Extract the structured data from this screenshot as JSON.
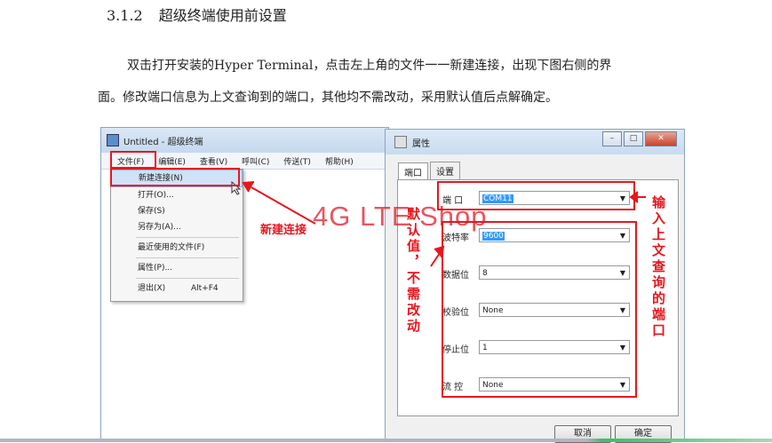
{
  "section": {
    "number": "3.1.2",
    "title": "超级终端使用前设置"
  },
  "paragraph": {
    "line1": "双击打开安装的Hyper Terminal，点击左上角的文件一一新建连接，出现下图右侧的界",
    "line2": "面。修改端口信息为上文查询到的端口，其他均不需改动，采用默认值后点解确定。"
  },
  "terminal_window": {
    "title": "Untitled - 超级终端",
    "menu": [
      "文件(F)",
      "编辑(E)",
      "查看(V)",
      "呼叫(C)",
      "传送(T)",
      "帮助(H)"
    ],
    "file_menu_items": [
      {
        "label": "新建连接(N)"
      },
      {
        "label": "打开(O)..."
      },
      {
        "label": "保存(S)"
      },
      {
        "label": "另存为(A)..."
      },
      {
        "label": "最近使用的文件(F)"
      },
      {
        "label": "属性(P)..."
      },
      {
        "label": "退出(X)",
        "shortcut": "Alt+F4"
      }
    ]
  },
  "properties_dialog": {
    "title": "属性",
    "tabs": [
      "端口",
      "设置"
    ],
    "fields": [
      {
        "label": "端 口",
        "value": "COM11"
      },
      {
        "label": "波特率",
        "value": "9600"
      },
      {
        "label": "数据位",
        "value": "8"
      },
      {
        "label": "校验位",
        "value": "None"
      },
      {
        "label": "停止位",
        "value": "1"
      },
      {
        "label": "流 控",
        "value": "None"
      }
    ],
    "buttons": {
      "cancel": "取消",
      "ok": "确定"
    }
  },
  "annotations": {
    "new_connection": "新建连接",
    "defaults_note": "默认值，不需改动",
    "port_note": "输入上文查询的端口",
    "watermark": "4G LTE Shop",
    "color": "#e8161e"
  }
}
